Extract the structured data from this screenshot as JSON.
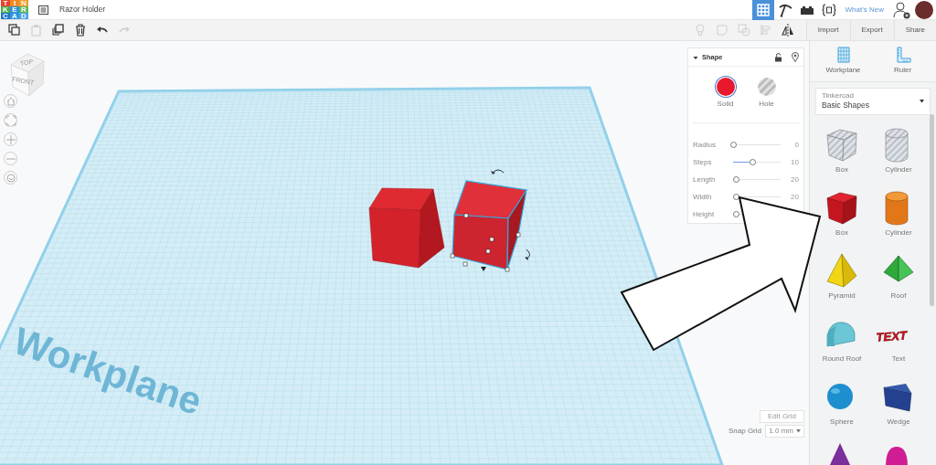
{
  "app": {
    "logo": [
      {
        "letter": "T",
        "color": "#e8432f"
      },
      {
        "letter": "I",
        "color": "#f08a24"
      },
      {
        "letter": "N",
        "color": "#f59c2c"
      },
      {
        "letter": "K",
        "color": "#4caf50"
      },
      {
        "letter": "E",
        "color": "#2b8fd6"
      },
      {
        "letter": "R",
        "color": "#5cb85c"
      },
      {
        "letter": "C",
        "color": "#1f78c8"
      },
      {
        "letter": "A",
        "color": "#2f96dd"
      },
      {
        "letter": "D",
        "color": "#4aa3e6"
      }
    ],
    "title": "Razor Holder"
  },
  "top_nav": [
    {
      "kind": "grid",
      "selected": true
    },
    {
      "kind": "pickaxe",
      "selected": false
    },
    {
      "kind": "bricks",
      "selected": false
    },
    {
      "kind": "code",
      "selected": false
    }
  ],
  "whats_new": "What's New",
  "toolbar": {
    "left": [
      {
        "kind": "copy",
        "disabled": false
      },
      {
        "kind": "paste",
        "disabled": true
      },
      {
        "kind": "duplicate",
        "disabled": false
      },
      {
        "kind": "delete",
        "disabled": false
      },
      {
        "kind": "undo",
        "disabled": false
      },
      {
        "kind": "redo",
        "disabled": true
      }
    ],
    "right": [
      {
        "kind": "bulb",
        "disabled": true
      },
      {
        "kind": "note",
        "disabled": true
      },
      {
        "kind": "group",
        "disabled": true
      },
      {
        "kind": "align",
        "disabled": true
      },
      {
        "kind": "mirror",
        "disabled": false
      }
    ],
    "buttons": [
      "Import",
      "Export",
      "Share"
    ]
  },
  "view_cube": {
    "top": "TOP",
    "front": "FRONT"
  },
  "nav_controls": [
    {
      "kind": "home"
    },
    {
      "kind": "fit"
    },
    {
      "kind": "zoom-in"
    },
    {
      "kind": "zoom-out"
    },
    {
      "kind": "orbit"
    }
  ],
  "workplane": {
    "label": "Workplane"
  },
  "objects": [
    {
      "kind": "box",
      "selected": false
    },
    {
      "kind": "box",
      "selected": true
    }
  ],
  "shape_panel": {
    "title": "Shape",
    "modes": [
      {
        "kind": "solid",
        "label": "Solid",
        "selected": true
      },
      {
        "kind": "hole",
        "label": "Hole",
        "selected": false
      }
    ],
    "params": [
      {
        "label": "Radius",
        "level": 0,
        "value": "0"
      },
      {
        "label": "Steps",
        "level": 0.4,
        "value": "10"
      },
      {
        "label": "Length",
        "level": 0.05,
        "value": "20"
      },
      {
        "label": "Width",
        "level": 0.05,
        "value": "20"
      },
      {
        "label": "Height",
        "level": 0.05
      }
    ]
  },
  "grid_controls": {
    "edit": "Edit Grid",
    "snap_label": "Snap Grid",
    "snap_value": "1.0 mm"
  },
  "right_panel": {
    "tools": [
      {
        "kind": "workplane",
        "label": "Workplane"
      },
      {
        "kind": "ruler",
        "label": "Ruler"
      }
    ],
    "library": {
      "source": "Tinkercad",
      "name": "Basic Shapes"
    },
    "shapes": [
      {
        "kind": "box-hole",
        "label": "Box"
      },
      {
        "kind": "cylinder-hole",
        "label": "Cylinder"
      },
      {
        "kind": "box",
        "label": "Box"
      },
      {
        "kind": "cylinder",
        "label": "Cylinder"
      },
      {
        "kind": "pyramid",
        "label": "Pyramid"
      },
      {
        "kind": "roof",
        "label": "Roof"
      },
      {
        "kind": "round-roof",
        "label": "Round Roof"
      },
      {
        "kind": "text",
        "label": "Text",
        "glyph": "TEXT"
      },
      {
        "kind": "sphere",
        "label": "Sphere"
      },
      {
        "kind": "wedge",
        "label": "Wedge"
      },
      {
        "kind": "cone"
      },
      {
        "kind": "paraboloid"
      }
    ]
  },
  "annotation": {
    "kind": "arrow"
  }
}
